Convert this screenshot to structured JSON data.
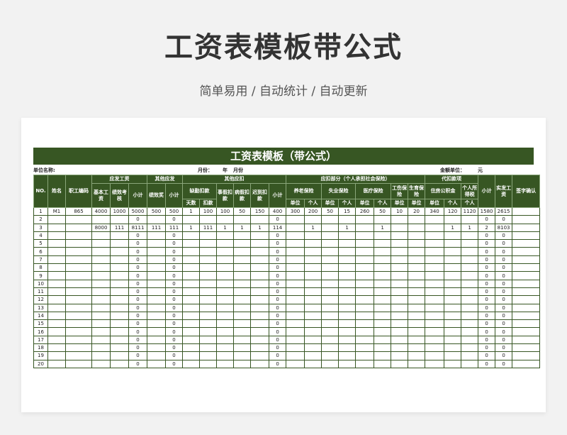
{
  "hero": {
    "title": "工资表模板带公式",
    "subtitle": "简单易用  /  自动统计  /  自动更新"
  },
  "sheet": {
    "title": "工资表模板（带公式）",
    "meta": {
      "unit_name_label": "单位名称:",
      "month_label": "月份：",
      "year_label": "年",
      "month_unit": "月份",
      "amount_unit_label": "金额单位：",
      "amount_unit": "元"
    },
    "headers": {
      "no": "NO.",
      "name": "姓名",
      "emp_code": "职工编码",
      "payable": "应发工资",
      "base": "基本工资",
      "perf_assess": "绩效考核",
      "subtotal": "小计",
      "other_payable": "其他应发",
      "bonus": "绩效奖",
      "subtotal2": "小计",
      "other_deduct": "其他应扣",
      "absence": "缺勤扣款",
      "days": "天数",
      "deduct": "扣款",
      "personal_leave": "事假扣款",
      "sick_leave": "病假扣款",
      "late": "迟到扣款",
      "subtotal3": "小计",
      "deduct_part": "应扣部分（个人承担社会保险）",
      "pension": "养老保险",
      "unemployment": "失业保险",
      "medical": "医疗保险",
      "injury": "工伤保险",
      "maternity": "生育保险",
      "unit": "单位",
      "personal": "个人",
      "withhold": "代扣款项",
      "housing_fund": "住房公积金",
      "income_tax": "个人所得税",
      "subtotal4": "小计",
      "net_pay": "实发工资",
      "signature": "签字确认"
    },
    "rows": [
      [
        "1",
        "M1",
        "865",
        "4000",
        "1000",
        "5000",
        "500",
        "500",
        "1",
        "100",
        "100",
        "50",
        "150",
        "400",
        "300",
        "200",
        "50",
        "15",
        "260",
        "50",
        "10",
        "20",
        "340",
        "120",
        "1120",
        "1580",
        "2615",
        ""
      ],
      [
        "2",
        "",
        "",
        "",
        "",
        "0",
        "",
        "0",
        "",
        "",
        "",
        "",
        "",
        "0",
        "",
        "",
        "",
        "",
        "",
        "",
        "",
        "",
        "",
        "",
        "",
        "0",
        "0",
        ""
      ],
      [
        "3",
        "",
        "",
        "8000",
        "111",
        "8111",
        "111",
        "111",
        "1",
        "111",
        "1",
        "1",
        "1",
        "114",
        "",
        "1",
        "",
        "1",
        "",
        "1",
        "",
        "",
        "",
        "1",
        "1",
        "2",
        "8103",
        ""
      ],
      [
        "4",
        "",
        "",
        "",
        "",
        "0",
        "",
        "0",
        "",
        "",
        "",
        "",
        "",
        "0",
        "",
        "",
        "",
        "",
        "",
        "",
        "",
        "",
        "",
        "",
        "",
        "0",
        "0",
        ""
      ],
      [
        "5",
        "",
        "",
        "",
        "",
        "0",
        "",
        "0",
        "",
        "",
        "",
        "",
        "",
        "0",
        "",
        "",
        "",
        "",
        "",
        "",
        "",
        "",
        "",
        "",
        "",
        "0",
        "0",
        ""
      ],
      [
        "6",
        "",
        "",
        "",
        "",
        "0",
        "",
        "0",
        "",
        "",
        "",
        "",
        "",
        "0",
        "",
        "",
        "",
        "",
        "",
        "",
        "",
        "",
        "",
        "",
        "",
        "0",
        "0",
        ""
      ],
      [
        "7",
        "",
        "",
        "",
        "",
        "0",
        "",
        "0",
        "",
        "",
        "",
        "",
        "",
        "0",
        "",
        "",
        "",
        "",
        "",
        "",
        "",
        "",
        "",
        "",
        "",
        "0",
        "0",
        ""
      ],
      [
        "8",
        "",
        "",
        "",
        "",
        "0",
        "",
        "0",
        "",
        "",
        "",
        "",
        "",
        "0",
        "",
        "",
        "",
        "",
        "",
        "",
        "",
        "",
        "",
        "",
        "",
        "0",
        "0",
        ""
      ],
      [
        "9",
        "",
        "",
        "",
        "",
        "0",
        "",
        "0",
        "",
        "",
        "",
        "",
        "",
        "0",
        "",
        "",
        "",
        "",
        "",
        "",
        "",
        "",
        "",
        "",
        "",
        "0",
        "0",
        ""
      ],
      [
        "10",
        "",
        "",
        "",
        "",
        "0",
        "",
        "0",
        "",
        "",
        "",
        "",
        "",
        "0",
        "",
        "",
        "",
        "",
        "",
        "",
        "",
        "",
        "",
        "",
        "",
        "0",
        "0",
        ""
      ],
      [
        "11",
        "",
        "",
        "",
        "",
        "0",
        "",
        "0",
        "",
        "",
        "",
        "",
        "",
        "0",
        "",
        "",
        "",
        "",
        "",
        "",
        "",
        "",
        "",
        "",
        "",
        "0",
        "0",
        ""
      ],
      [
        "12",
        "",
        "",
        "",
        "",
        "0",
        "",
        "0",
        "",
        "",
        "",
        "",
        "",
        "0",
        "",
        "",
        "",
        "",
        "",
        "",
        "",
        "",
        "",
        "",
        "",
        "0",
        "0",
        ""
      ],
      [
        "13",
        "",
        "",
        "",
        "",
        "0",
        "",
        "0",
        "",
        "",
        "",
        "",
        "",
        "0",
        "",
        "",
        "",
        "",
        "",
        "",
        "",
        "",
        "",
        "",
        "",
        "0",
        "0",
        ""
      ],
      [
        "14",
        "",
        "",
        "",
        "",
        "0",
        "",
        "0",
        "",
        "",
        "",
        "",
        "",
        "0",
        "",
        "",
        "",
        "",
        "",
        "",
        "",
        "",
        "",
        "",
        "",
        "0",
        "0",
        ""
      ],
      [
        "15",
        "",
        "",
        "",
        "",
        "0",
        "",
        "0",
        "",
        "",
        "",
        "",
        "",
        "0",
        "",
        "",
        "",
        "",
        "",
        "",
        "",
        "",
        "",
        "",
        "",
        "0",
        "0",
        ""
      ],
      [
        "16",
        "",
        "",
        "",
        "",
        "0",
        "",
        "0",
        "",
        "",
        "",
        "",
        "",
        "0",
        "",
        "",
        "",
        "",
        "",
        "",
        "",
        "",
        "",
        "",
        "",
        "0",
        "0",
        ""
      ],
      [
        "17",
        "",
        "",
        "",
        "",
        "0",
        "",
        "0",
        "",
        "",
        "",
        "",
        "",
        "0",
        "",
        "",
        "",
        "",
        "",
        "",
        "",
        "",
        "",
        "",
        "",
        "0",
        "0",
        ""
      ],
      [
        "18",
        "",
        "",
        "",
        "",
        "0",
        "",
        "0",
        "",
        "",
        "",
        "",
        "",
        "0",
        "",
        "",
        "",
        "",
        "",
        "",
        "",
        "",
        "",
        "",
        "",
        "0",
        "0",
        ""
      ],
      [
        "19",
        "",
        "",
        "",
        "",
        "0",
        "",
        "0",
        "",
        "",
        "",
        "",
        "",
        "0",
        "",
        "",
        "",
        "",
        "",
        "",
        "",
        "",
        "",
        "",
        "",
        "0",
        "0",
        ""
      ],
      [
        "20",
        "",
        "",
        "",
        "",
        "0",
        "",
        "0",
        "",
        "",
        "",
        "",
        "",
        "0",
        "",
        "",
        "",
        "",
        "",
        "",
        "",
        "",
        "",
        "",
        "",
        "0",
        "0",
        ""
      ]
    ]
  },
  "colors": {
    "header_green": "#375623",
    "page_bg": "#f2f2f2"
  }
}
